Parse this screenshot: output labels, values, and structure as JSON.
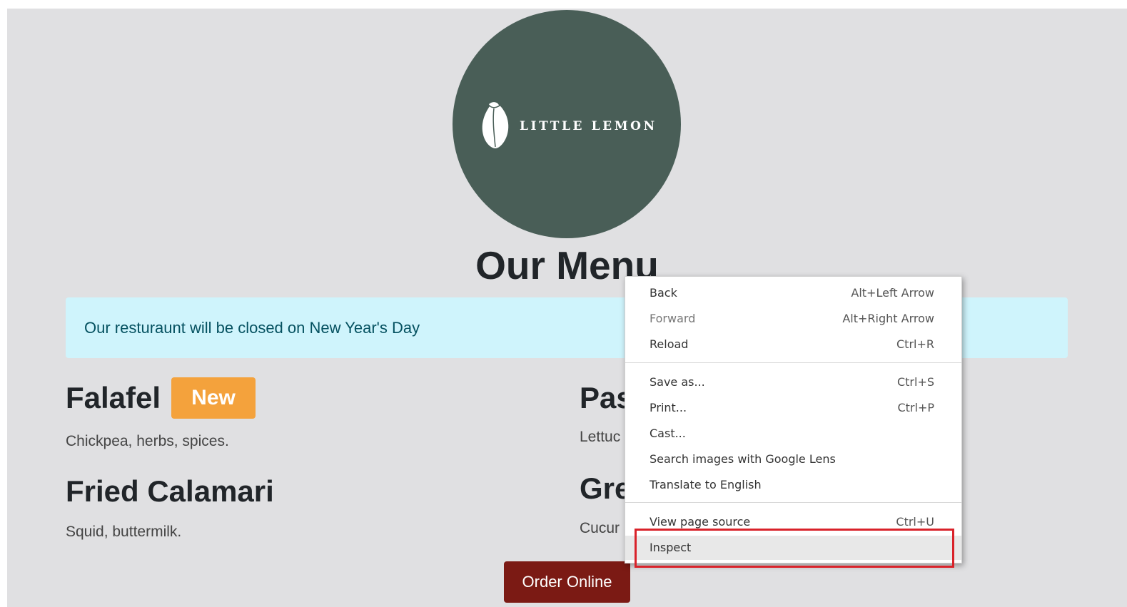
{
  "logo": {
    "brand": "LITTLE LEMON",
    "icon": "lemon-icon"
  },
  "title": "Our Menu",
  "alert": "Our resturaunt will be closed on New Year's Day",
  "menu": {
    "items": [
      {
        "name": "Falafel",
        "badge": "New",
        "desc": "Chickpea, herbs, spices."
      },
      {
        "name": "Pas",
        "desc": "Lettuc"
      },
      {
        "name": "Fried Calamari",
        "desc": "Squid, buttermilk."
      },
      {
        "name": "Gre",
        "desc": "Cucur"
      }
    ]
  },
  "order_button": "Order Online",
  "context_menu": {
    "items": [
      {
        "label": "Back",
        "shortcut": "Alt+Left Arrow"
      },
      {
        "label": "Forward",
        "shortcut": "Alt+Right Arrow"
      },
      {
        "label": "Reload",
        "shortcut": "Ctrl+R"
      },
      {
        "label": "Save as...",
        "shortcut": "Ctrl+S"
      },
      {
        "label": "Print...",
        "shortcut": "Ctrl+P"
      },
      {
        "label": "Cast...",
        "shortcut": ""
      },
      {
        "label": "Search images with Google Lens",
        "shortcut": ""
      },
      {
        "label": "Translate to English",
        "shortcut": ""
      },
      {
        "label": "View page source",
        "shortcut": "Ctrl+U"
      },
      {
        "label": "Inspect",
        "shortcut": ""
      }
    ]
  },
  "colors": {
    "page_bg": "#e0e0e2",
    "logo_bg": "#495e57",
    "alert_bg": "#cff4fc",
    "badge_bg": "#f4a23c",
    "order_button_bg": "#7b1a14",
    "highlight": "#d9222a"
  }
}
